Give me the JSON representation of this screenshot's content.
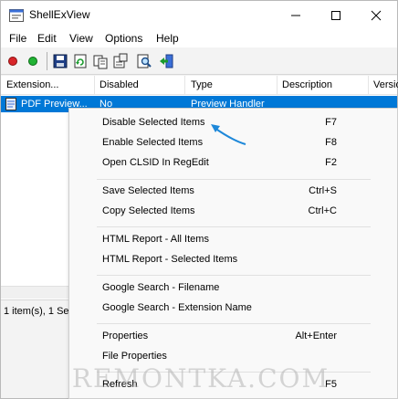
{
  "window": {
    "title": "ShellExView",
    "controls": [
      "minimize",
      "maximize",
      "close"
    ]
  },
  "menubar": {
    "items": [
      "File",
      "Edit",
      "View",
      "Options",
      "Help"
    ]
  },
  "toolbar": {
    "icons": [
      "red-dot-icon",
      "green-dot-icon",
      "save-icon",
      "refresh-icon",
      "copy-icon",
      "properties-icon",
      "search-icon",
      "exit-icon"
    ]
  },
  "list": {
    "columns": [
      "Extension...",
      "Disabled",
      "Type",
      "Description",
      "Versio"
    ],
    "selected_row": {
      "extension": "PDF Preview...",
      "disabled": "No",
      "type": "Preview Handler"
    }
  },
  "status": {
    "text": "1 item(s), 1 Se"
  },
  "context_menu": {
    "items": [
      {
        "label": "Disable Selected Items",
        "shortcut": "F7"
      },
      {
        "label": "Enable Selected Items",
        "shortcut": "F8"
      },
      {
        "label": "Open CLSID In RegEdit",
        "shortcut": "F2"
      },
      {
        "label": "Save Selected Items",
        "shortcut": "Ctrl+S"
      },
      {
        "label": "Copy Selected Items",
        "shortcut": "Ctrl+C"
      },
      {
        "label": "HTML Report - All Items",
        "shortcut": ""
      },
      {
        "label": "HTML Report - Selected Items",
        "shortcut": ""
      },
      {
        "label": "Google Search - Filename",
        "shortcut": ""
      },
      {
        "label": "Google Search - Extension Name",
        "shortcut": ""
      },
      {
        "label": "Properties",
        "shortcut": "Alt+Enter"
      },
      {
        "label": "File Properties",
        "shortcut": ""
      },
      {
        "label": "Refresh",
        "shortcut": "F5"
      }
    ]
  },
  "watermark": "REMONTKA.COM",
  "colors": {
    "selection": "#0078d7",
    "arrow": "#1e88d9"
  }
}
